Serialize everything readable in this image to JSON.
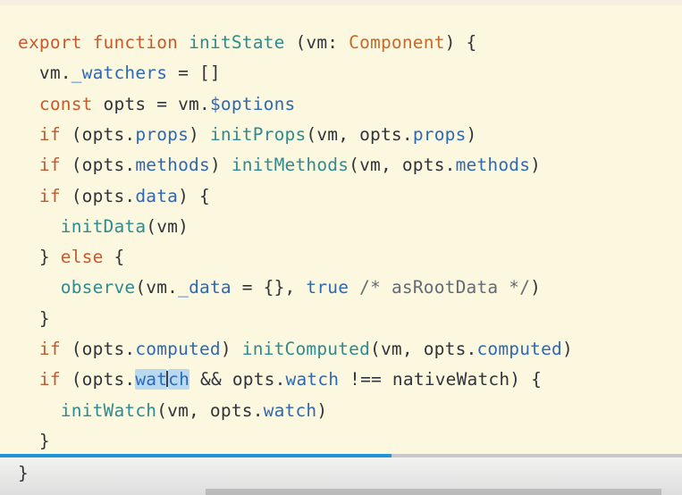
{
  "progress": {
    "value_percent": 57.4,
    "color": "#1f95d8"
  },
  "code": {
    "lines": [
      [
        {
          "text": "export ",
          "kind": "kw"
        },
        {
          "text": "function ",
          "kind": "kw"
        },
        {
          "text": "initState",
          "kind": "fn"
        },
        {
          "text": " (vm: ",
          "kind": "plain"
        },
        {
          "text": "Component",
          "kind": "ty"
        },
        {
          "text": ") {",
          "kind": "plain"
        }
      ],
      [
        {
          "text": "  vm.",
          "kind": "plain"
        },
        {
          "text": "_watchers",
          "kind": "prop"
        },
        {
          "text": " = []",
          "kind": "plain"
        }
      ],
      [
        {
          "text": "  const ",
          "kind": "kw"
        },
        {
          "text": "opts = vm.",
          "kind": "plain"
        },
        {
          "text": "$options",
          "kind": "prop"
        }
      ],
      [
        {
          "text": "  if ",
          "kind": "kw"
        },
        {
          "text": "(opts.",
          "kind": "plain"
        },
        {
          "text": "props",
          "kind": "prop"
        },
        {
          "text": ") ",
          "kind": "plain"
        },
        {
          "text": "initProps",
          "kind": "fn"
        },
        {
          "text": "(vm, opts.",
          "kind": "plain"
        },
        {
          "text": "props",
          "kind": "prop"
        },
        {
          "text": ")",
          "kind": "plain"
        }
      ],
      [
        {
          "text": "  if ",
          "kind": "kw"
        },
        {
          "text": "(opts.",
          "kind": "plain"
        },
        {
          "text": "methods",
          "kind": "prop"
        },
        {
          "text": ") ",
          "kind": "plain"
        },
        {
          "text": "initMethods",
          "kind": "fn"
        },
        {
          "text": "(vm, opts.",
          "kind": "plain"
        },
        {
          "text": "methods",
          "kind": "prop"
        },
        {
          "text": ")",
          "kind": "plain"
        }
      ],
      [
        {
          "text": "  if ",
          "kind": "kw"
        },
        {
          "text": "(opts.",
          "kind": "plain"
        },
        {
          "text": "data",
          "kind": "prop"
        },
        {
          "text": ") {",
          "kind": "plain"
        }
      ],
      [
        {
          "text": "    ",
          "kind": "plain"
        },
        {
          "text": "initData",
          "kind": "fn"
        },
        {
          "text": "(vm)",
          "kind": "plain"
        }
      ],
      [
        {
          "text": "  } ",
          "kind": "plain"
        },
        {
          "text": "else ",
          "kind": "kw"
        },
        {
          "text": "{",
          "kind": "plain"
        }
      ],
      [
        {
          "text": "    ",
          "kind": "plain"
        },
        {
          "text": "observe",
          "kind": "fn"
        },
        {
          "text": "(vm.",
          "kind": "plain"
        },
        {
          "text": "_data",
          "kind": "prop"
        },
        {
          "text": " = {}, ",
          "kind": "plain"
        },
        {
          "text": "true",
          "kind": "lit"
        },
        {
          "text": " /* asRootData */",
          "kind": "cm"
        },
        {
          "text": ")",
          "kind": "plain"
        }
      ],
      [
        {
          "text": "  }",
          "kind": "plain"
        }
      ],
      [
        {
          "text": "  if ",
          "kind": "kw"
        },
        {
          "text": "(opts.",
          "kind": "plain"
        },
        {
          "text": "computed",
          "kind": "prop"
        },
        {
          "text": ") ",
          "kind": "plain"
        },
        {
          "text": "initComputed",
          "kind": "fn"
        },
        {
          "text": "(vm, opts.",
          "kind": "plain"
        },
        {
          "text": "computed",
          "kind": "prop"
        },
        {
          "text": ")",
          "kind": "plain"
        }
      ],
      [
        {
          "text": "  if ",
          "kind": "kw"
        },
        {
          "text": "(opts.",
          "kind": "plain"
        },
        {
          "text": "wat",
          "kind": "prop_sel"
        },
        {
          "text": "",
          "kind": "cursor"
        },
        {
          "text": "ch",
          "kind": "prop_sel"
        },
        {
          "text": " && opts.",
          "kind": "plain"
        },
        {
          "text": "watch",
          "kind": "prop"
        },
        {
          "text": " !== nativeWatch) {",
          "kind": "plain"
        }
      ],
      [
        {
          "text": "    ",
          "kind": "plain"
        },
        {
          "text": "initWatch",
          "kind": "fn"
        },
        {
          "text": "(vm, opts.",
          "kind": "plain"
        },
        {
          "text": "watch",
          "kind": "prop"
        },
        {
          "text": ")",
          "kind": "plain"
        }
      ],
      [
        {
          "text": "  }",
          "kind": "plain"
        }
      ]
    ],
    "closing": "}"
  }
}
